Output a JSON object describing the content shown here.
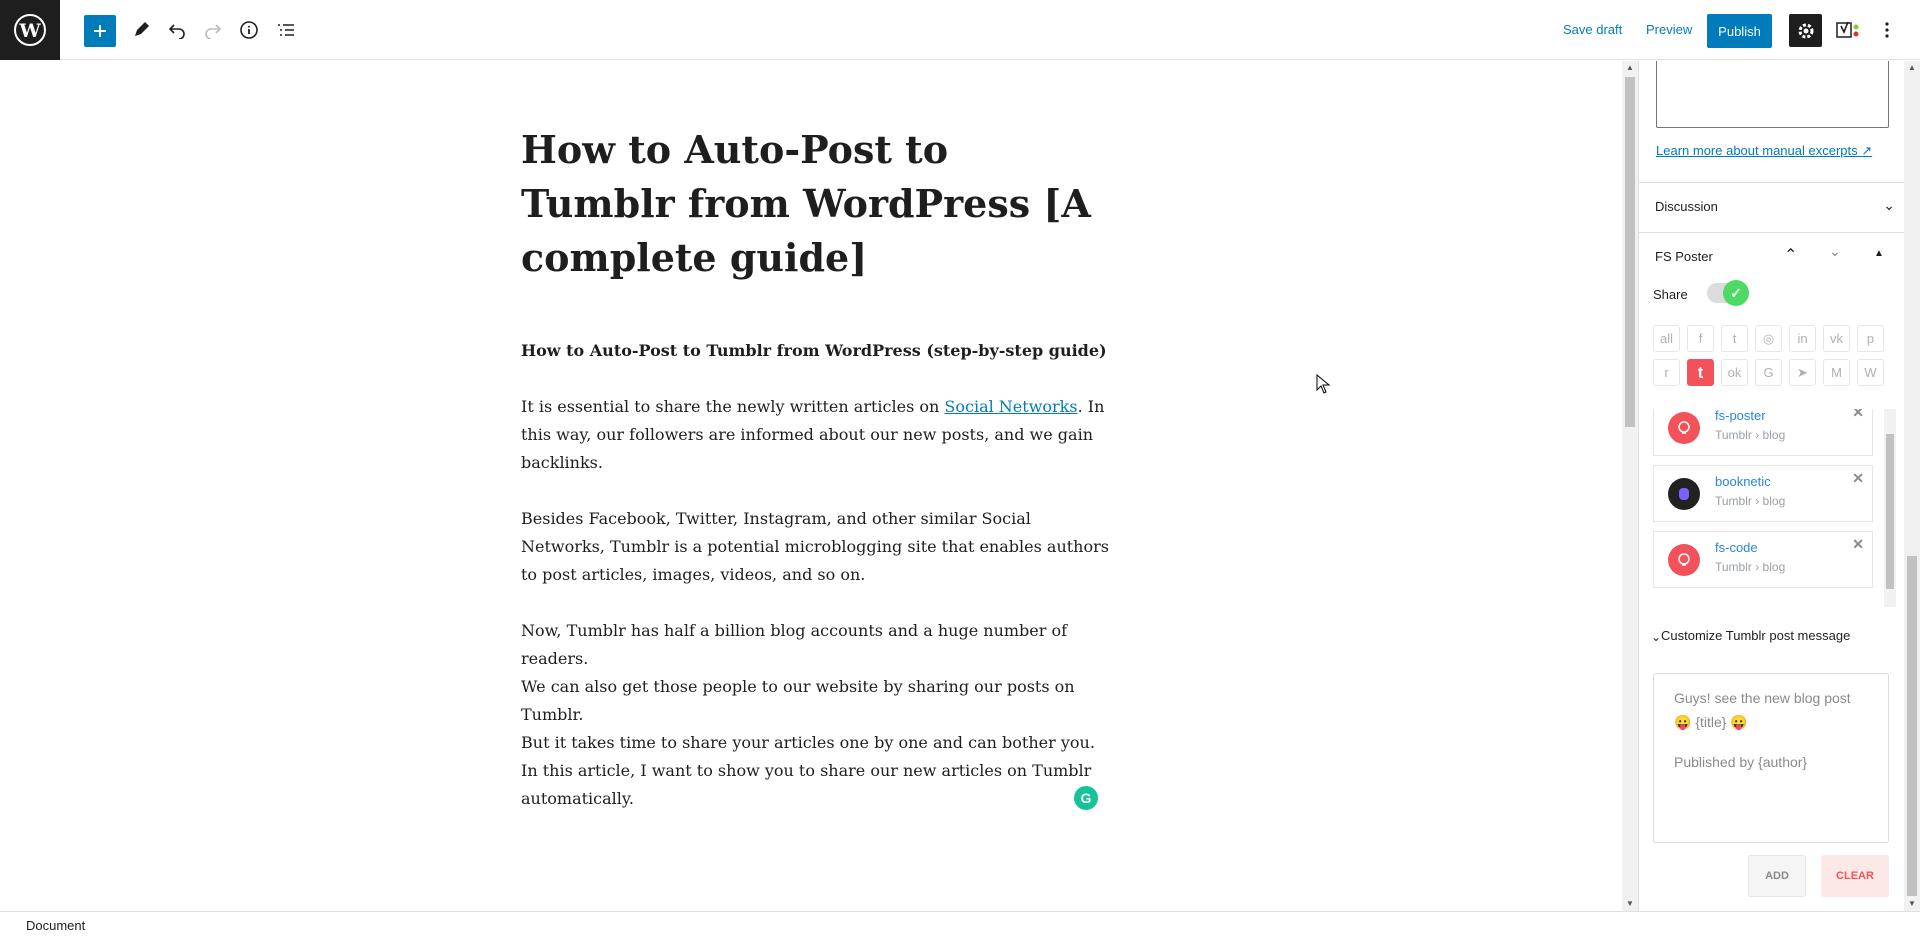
{
  "toolbar": {
    "save_draft": "Save draft",
    "preview": "Preview",
    "publish": "Publish"
  },
  "post": {
    "title": "How to Auto-Post to Tumblr from WordPress [A complete guide]",
    "subtitle": "How to Auto-Post to Tumblr from WordPress (step-by-step guide)",
    "p1_before": "It is essential to share the newly written articles on ",
    "p1_link": "Social Networks",
    "p1_after": ". In this way, our followers are informed about our new posts, and we gain backlinks.",
    "p2": "Besides Facebook, Twitter, Instagram, and other similar Social Networks, Tumblr is a potential microblogging site that enables authors to post articles, images, videos, and so on.",
    "p3": "Now, Tumblr has half a billion blog accounts and a huge number of readers.",
    "p4": "We can also get those people to our website by sharing our posts on Tumblr.",
    "p5": "But it takes time to share your articles one by one and can bother you. In this article, I want to show you to share our new articles on Tumblr automatically."
  },
  "sidebar": {
    "learn_excerpts": "Learn more about manual excerpts",
    "discussion": "Discussion",
    "fs_poster": "FS Poster",
    "share": "Share",
    "networks_row1": [
      "all",
      "f",
      "t",
      "◎",
      "in",
      "vk",
      "p"
    ],
    "networks_row2": [
      "r",
      "t",
      "ok",
      "G",
      "➤",
      "M",
      "W"
    ],
    "accounts": [
      {
        "name": "fs-poster",
        "sub": "Tumblr › blog"
      },
      {
        "name": "booknetic",
        "sub": "Tumblr › blog"
      },
      {
        "name": "fs-code",
        "sub": "Tumblr › blog"
      }
    ],
    "customize_label": "Customize Tumblr post message",
    "message_line1": "Guys! see the new blog post 😛 {title} 😛",
    "message_line2": "Published by {author}",
    "add": "ADD",
    "clear": "CLEAR"
  },
  "footer": {
    "breadcrumb": "Document"
  },
  "colors": {
    "accent": "#007cba",
    "tumblr_red": "#f3525a",
    "toggle_green": "#4cd964"
  }
}
